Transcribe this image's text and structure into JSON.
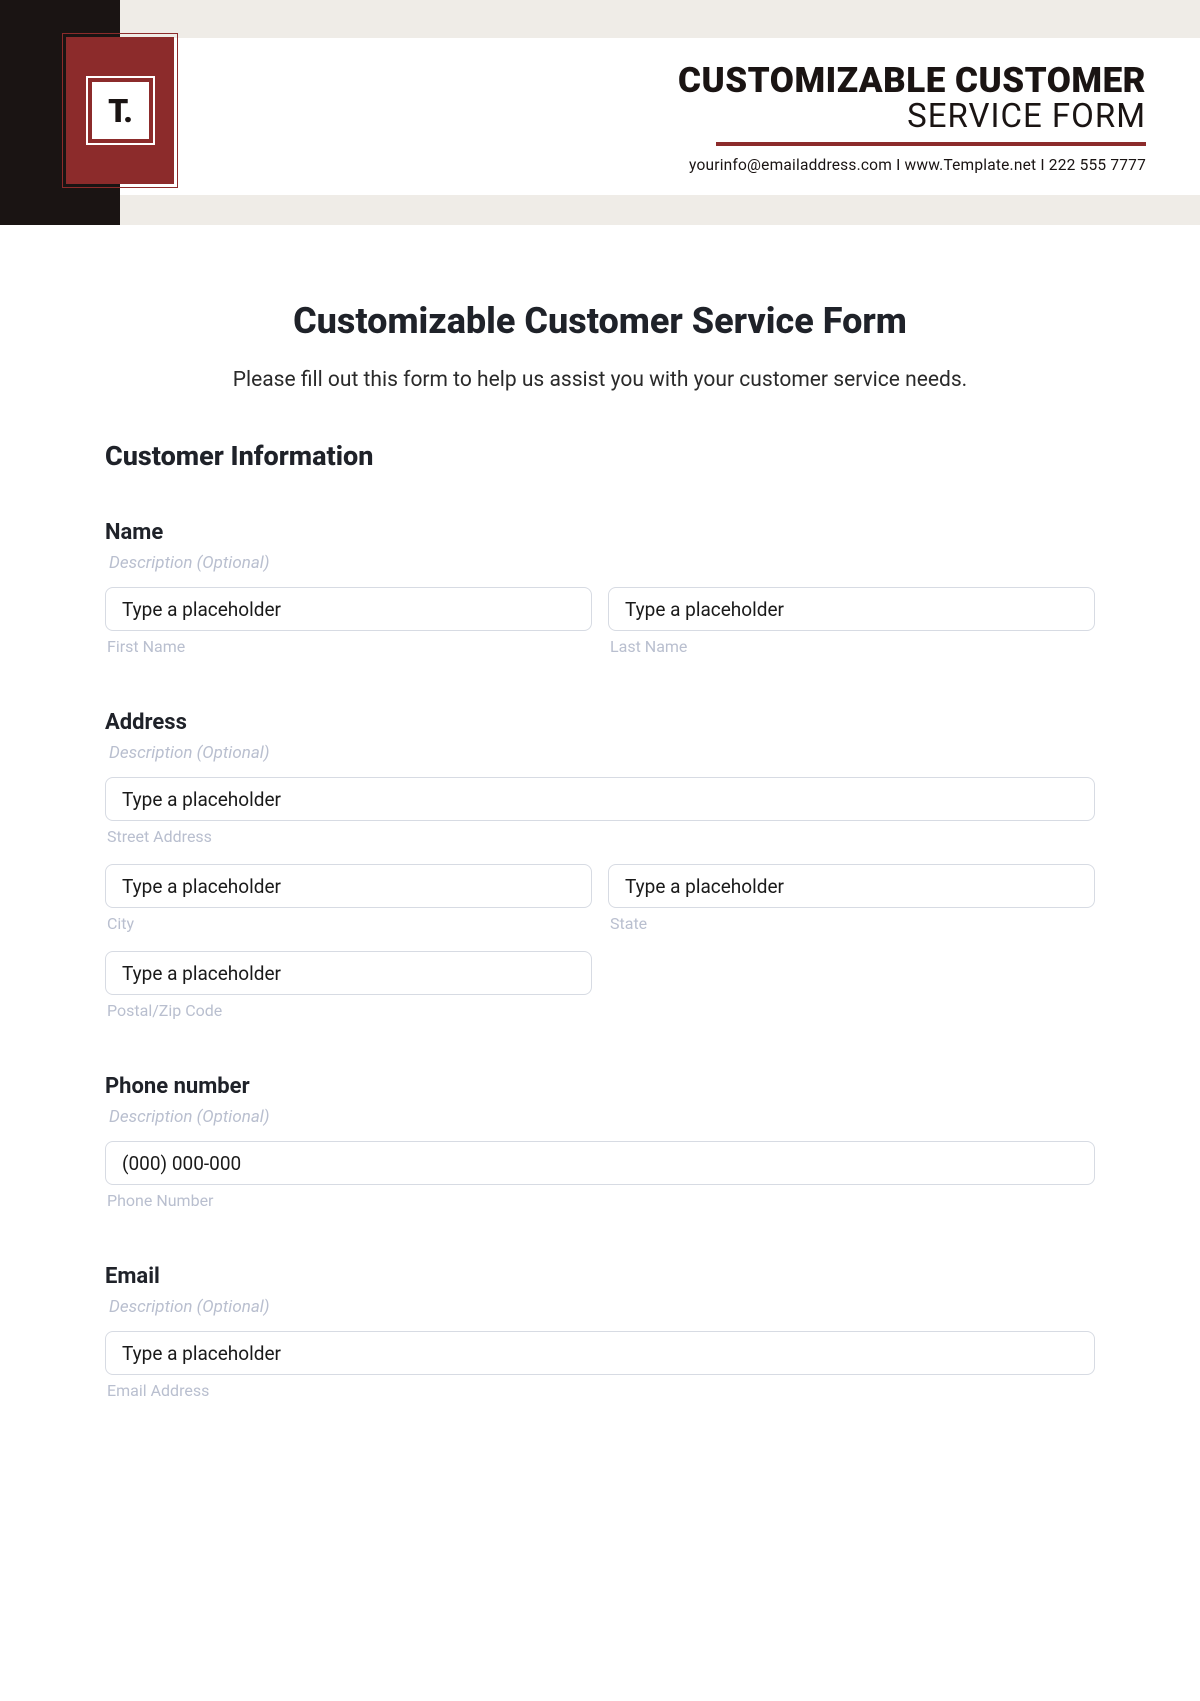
{
  "header": {
    "logo_text": "T.",
    "title_line1": "CUSTOMIZABLE CUSTOMER",
    "title_line2": "SERVICE FORM",
    "contact_email": "yourinfo@emailaddress.com",
    "contact_sep": "  I  ",
    "contact_website": "www.Template.net",
    "contact_phone": "222 555 7777"
  },
  "form": {
    "title": "Customizable Customer Service Form",
    "subtitle": "Please fill out this form to help us assist you with your customer service needs.",
    "section_heading": "Customer Information",
    "desc_optional": "Description (Optional)",
    "placeholder_generic": "Type a placeholder",
    "name": {
      "label": "Name",
      "first_sub": "First Name",
      "last_sub": "Last Name"
    },
    "address": {
      "label": "Address",
      "street_sub": "Street Address",
      "city_sub": "City",
      "state_sub": "State",
      "postal_sub": "Postal/Zip Code"
    },
    "phone": {
      "label": "Phone number",
      "placeholder": "(000) 000-000",
      "sub": "Phone Number"
    },
    "email": {
      "label": "Email",
      "sub": "Email Address"
    }
  }
}
